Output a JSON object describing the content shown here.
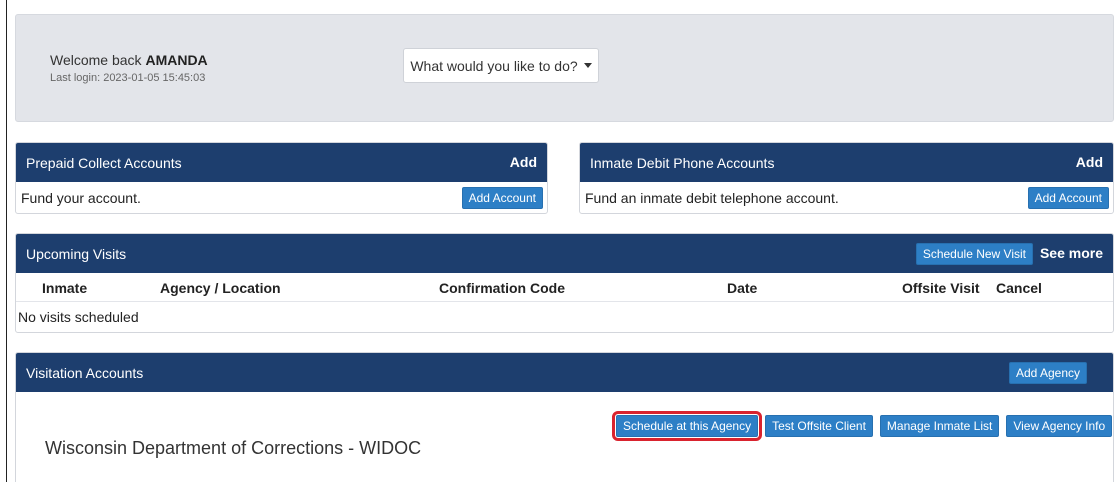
{
  "welcome": {
    "greeting": "Welcome back ",
    "user_name": "AMANDA",
    "last_login": "Last login: 2023-01-05 15:45:03",
    "action_dropdown_label": "What would you like to do?"
  },
  "prepaid_collect": {
    "title": "Prepaid Collect Accounts",
    "header_action": "Add",
    "description": "Fund your account.",
    "button_label": "Add Account"
  },
  "inmate_debit": {
    "title": "Inmate Debit Phone Accounts",
    "header_action": "Add",
    "description": "Fund an inmate debit telephone account.",
    "button_label": "Add Account"
  },
  "upcoming_visits": {
    "title": "Upcoming Visits",
    "schedule_button": "Schedule New Visit",
    "see_more": "See more",
    "columns": [
      "Inmate",
      "Agency / Location",
      "Confirmation Code",
      "Date",
      "Offsite Visit",
      "Cancel"
    ],
    "empty_message": "No visits scheduled"
  },
  "visitation_accounts": {
    "title": "Visitation Accounts",
    "add_agency_button": "Add Agency",
    "agency": {
      "name": "Wisconsin Department of Corrections - WIDOC",
      "buttons": [
        "Schedule at this Agency",
        "Test Offsite Client",
        "Manage Inmate List",
        "View Agency Info"
      ]
    }
  },
  "colors": {
    "header_navy": "#1d3e6e",
    "button_blue": "#2d7fc6",
    "highlight_red": "#d9232e",
    "welcome_bg": "#e3e5ea"
  }
}
